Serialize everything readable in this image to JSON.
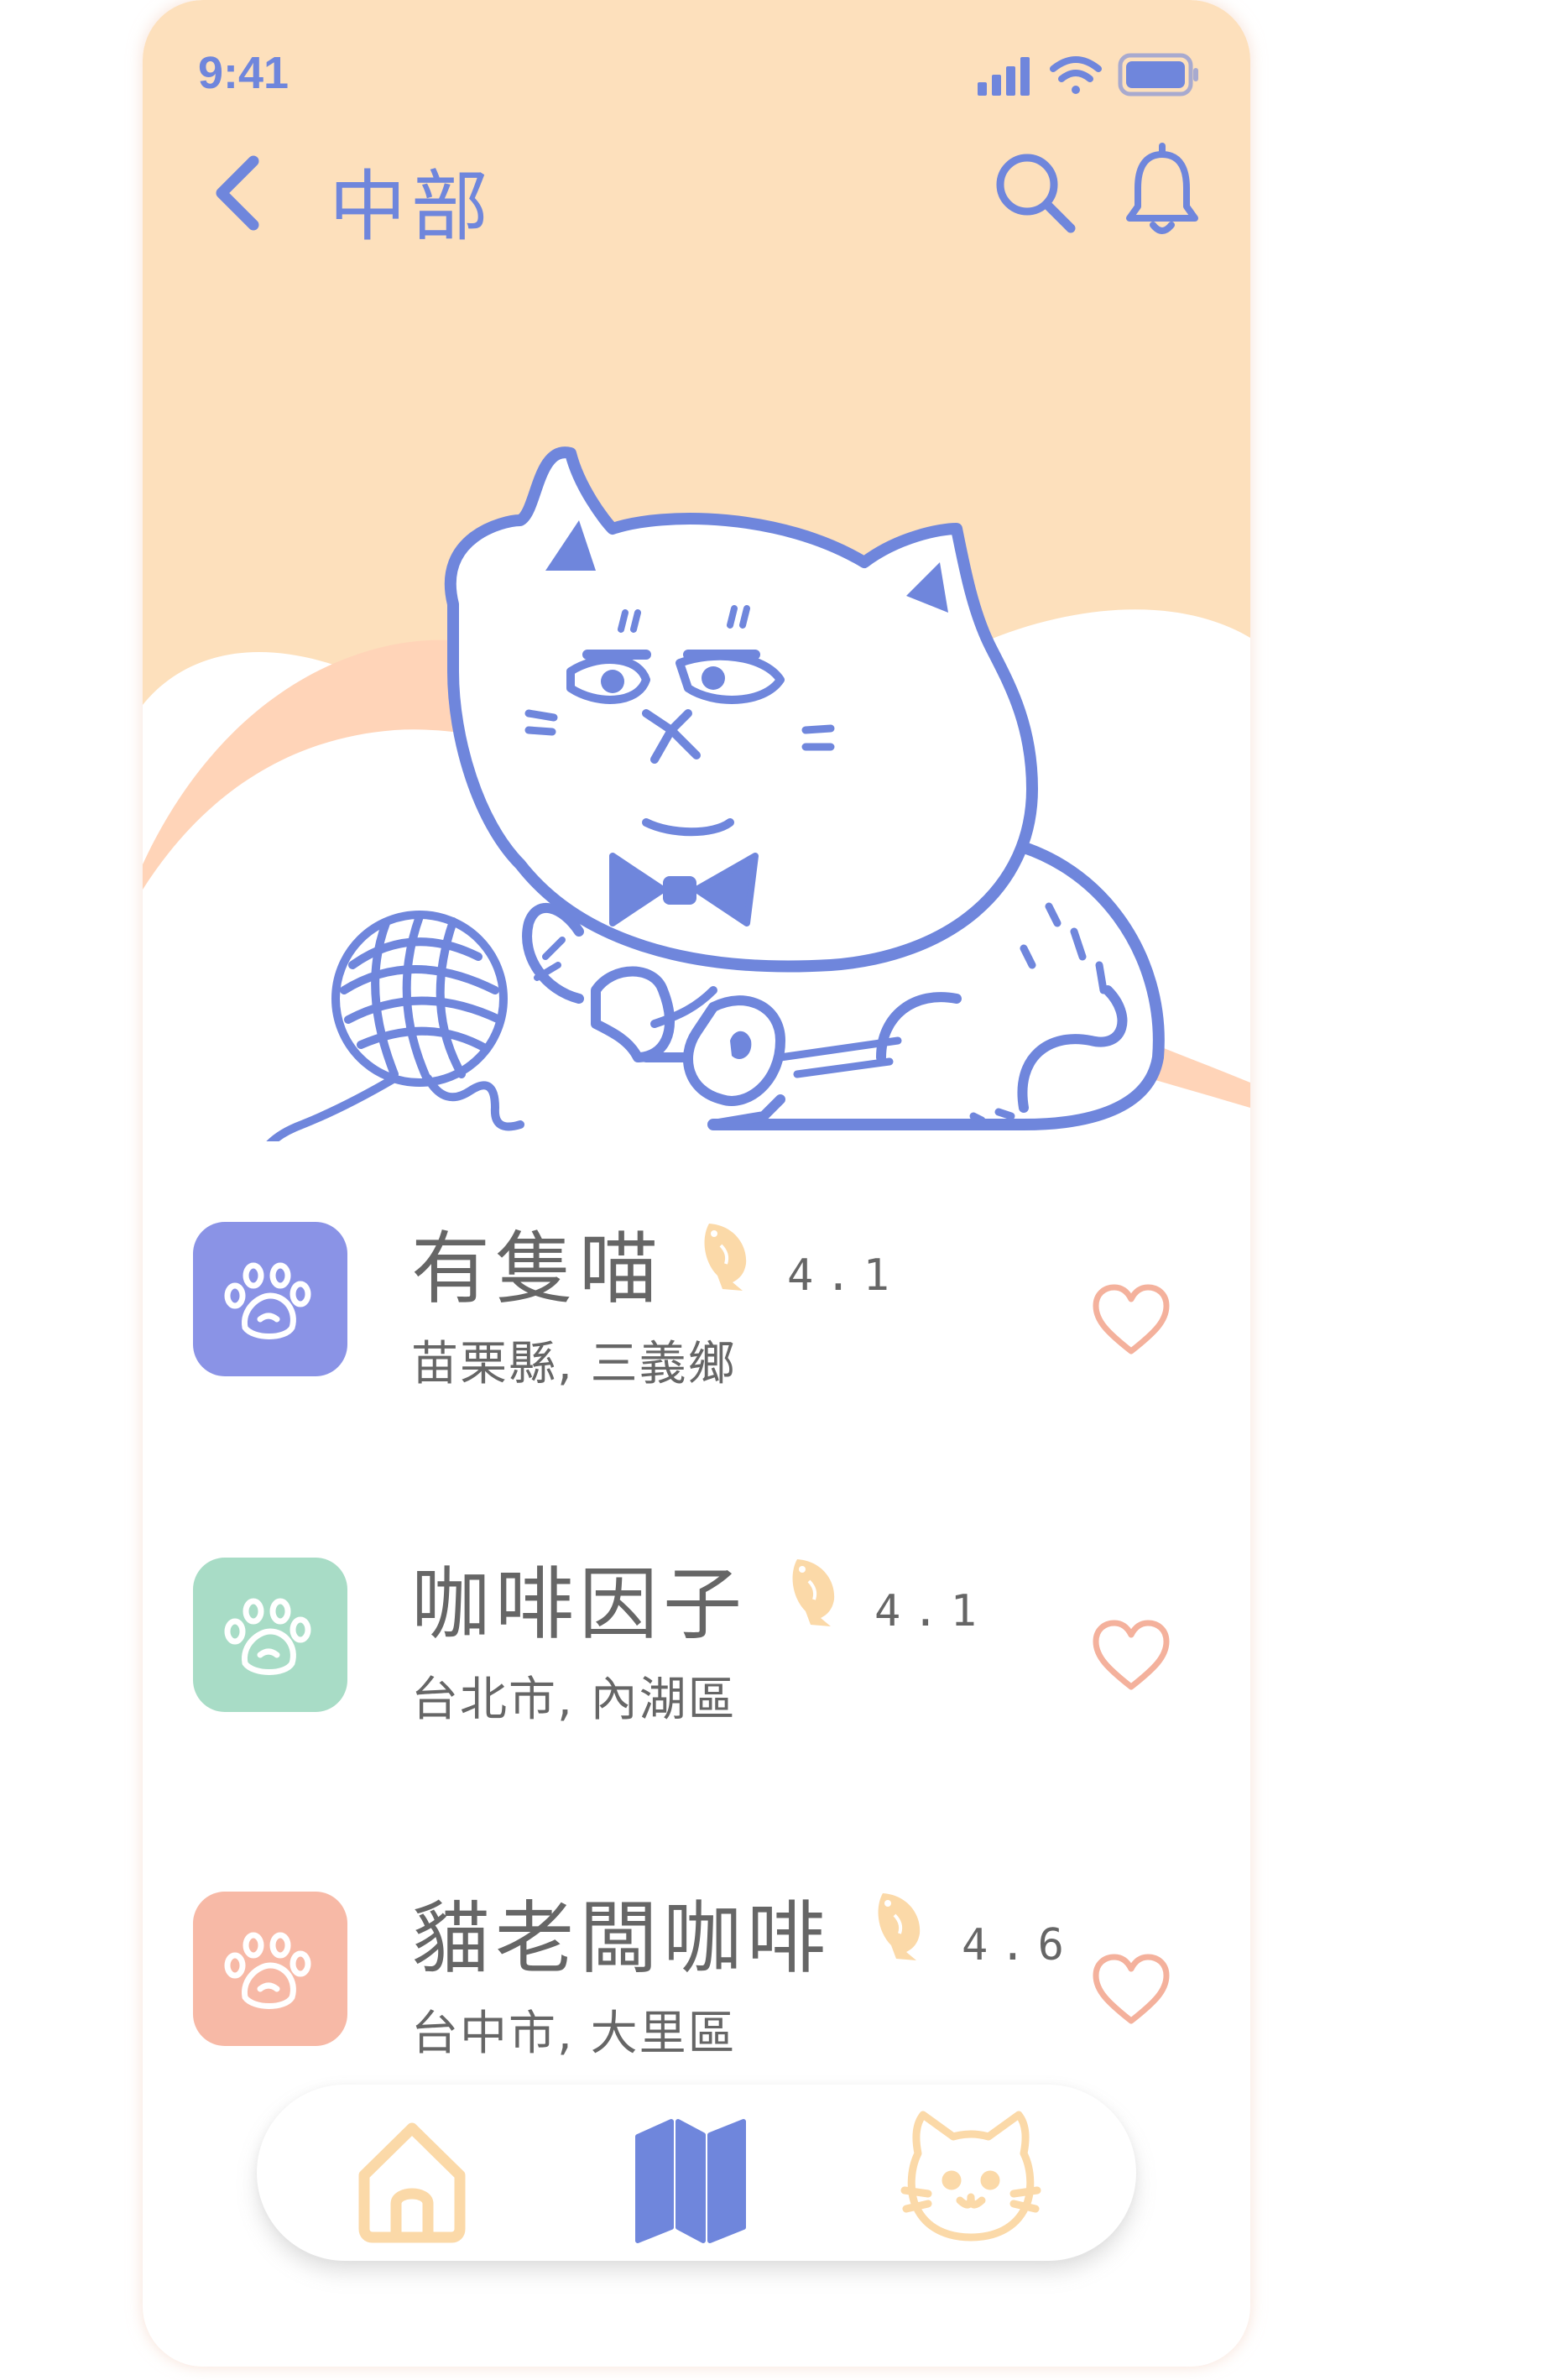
{
  "status_bar": {
    "time": "9:41"
  },
  "header": {
    "title": "中部"
  },
  "cafes": [
    {
      "name": "有隻喵",
      "rating": "4.1",
      "location": "苗栗縣, 三義鄉",
      "tile_color": "#8a93e6",
      "tile_icon": "paw-icon"
    },
    {
      "name": "咖啡因子",
      "rating": "4.1",
      "location": "台北市, 內湖區",
      "tile_color": "#a8dcc6",
      "tile_icon": "paw-icon"
    },
    {
      "name": "貓老闆咖啡",
      "rating": "4.6",
      "location": "台中市, 大里區",
      "tile_color": "#f7b9a6",
      "tile_icon": "paw-icon"
    }
  ],
  "tab_bar": {
    "tabs": [
      {
        "icon": "home-icon",
        "color": "#fbd9a8"
      },
      {
        "icon": "map-icon",
        "color": "#6f86dc",
        "active": true
      },
      {
        "icon": "cat-face-icon",
        "color": "#fbd9a8"
      }
    ]
  },
  "colors": {
    "accent": "#6f86dc",
    "hero_background": "#fde0bc",
    "wave_peach": "#ffd4b8",
    "heart": "#f4b19c",
    "fish": "#fbd9a8",
    "text": "#666666"
  }
}
